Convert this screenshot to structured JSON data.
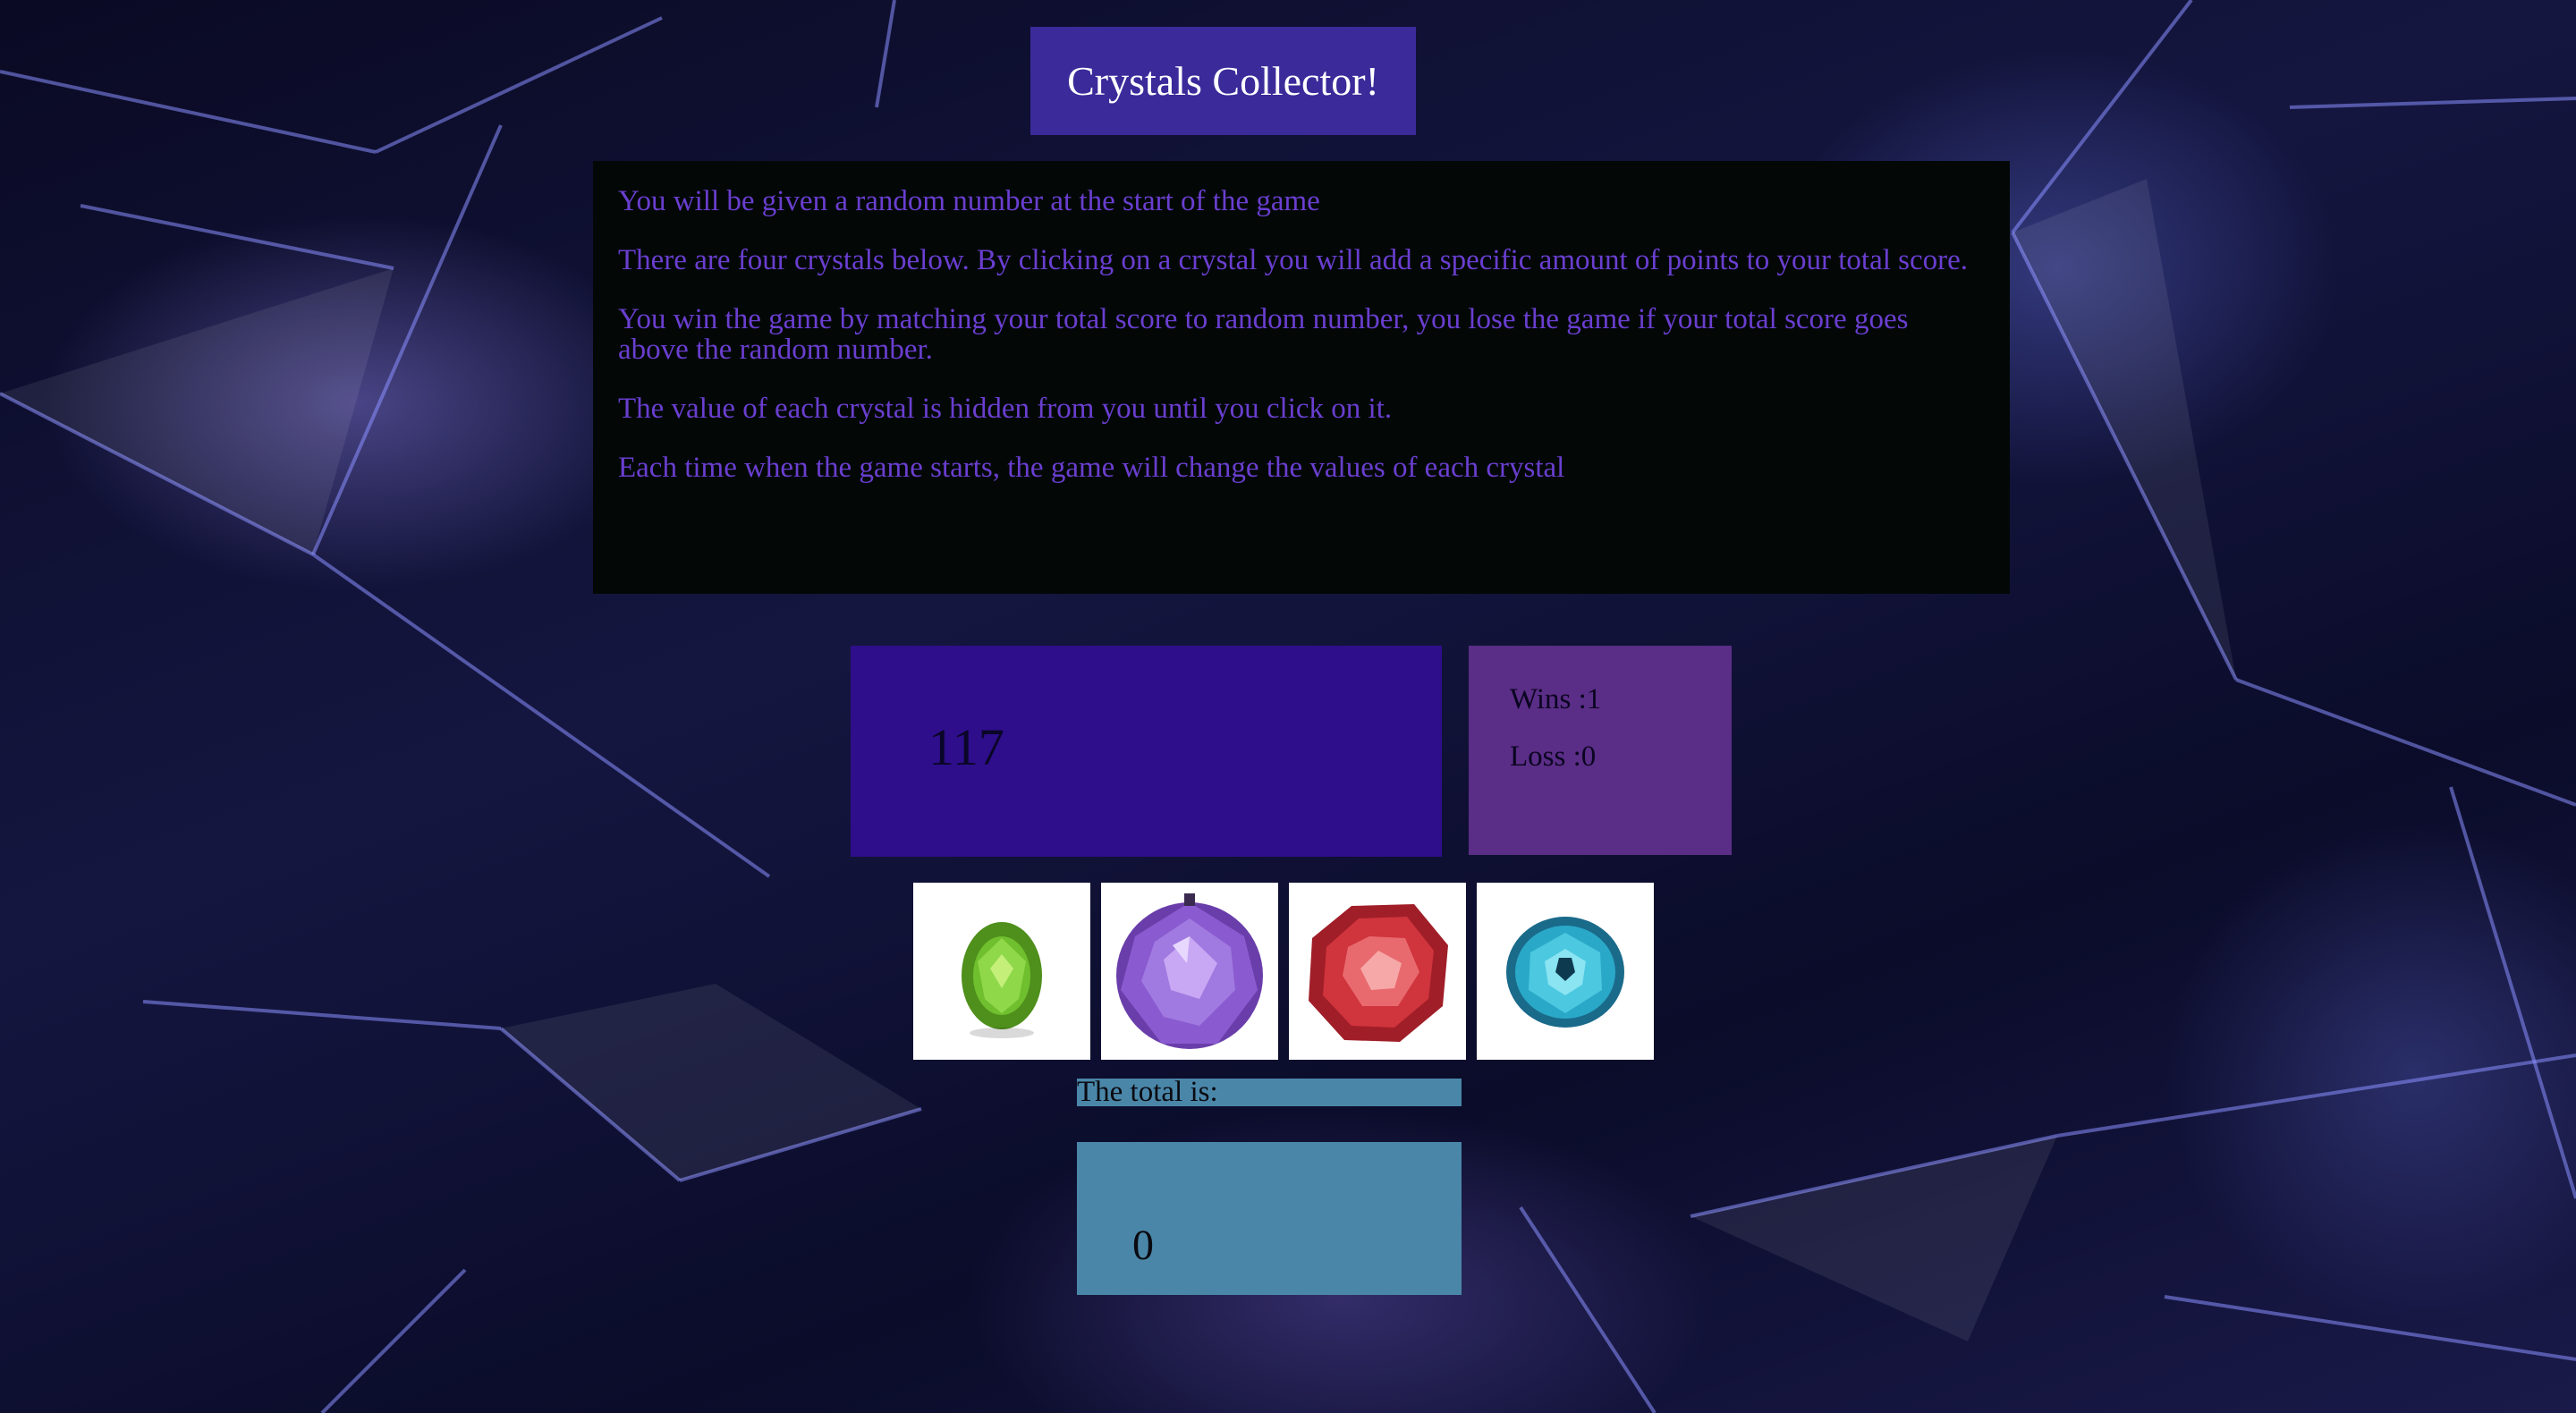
{
  "title": "Crystals Collector!",
  "instructions": [
    "You will be given a random number at the start of the game",
    "There are four crystals below. By clicking on a crystal you will add a specific amount of points to your total score.",
    "You win the game by matching your total score to random number, you lose the game if your total score goes above the random number.",
    "The value of each crystal is hidden from you until you click on it.",
    "Each time when the game starts, the game will change the values of each crystal"
  ],
  "target_number": "117",
  "scoreboard": {
    "wins": "Wins :1",
    "loss": "Loss :0"
  },
  "crystals": [
    {
      "icon": "green-crystal-icon",
      "color": "#5aa82a"
    },
    {
      "icon": "purple-crystal-icon",
      "color": "#8a5ad0"
    },
    {
      "icon": "red-crystal-icon",
      "color": "#d0343c"
    },
    {
      "icon": "blue-crystal-icon",
      "color": "#2aa8c8"
    }
  ],
  "total": {
    "label": "The total is:",
    "value": "0"
  },
  "colors": {
    "title_bg": "#3b2a9a",
    "instructions_text": "#6a3ed0",
    "target_bg": "#2e0e8a",
    "score_bg": "#5a2d86",
    "total_bg": "#4a86a8"
  }
}
